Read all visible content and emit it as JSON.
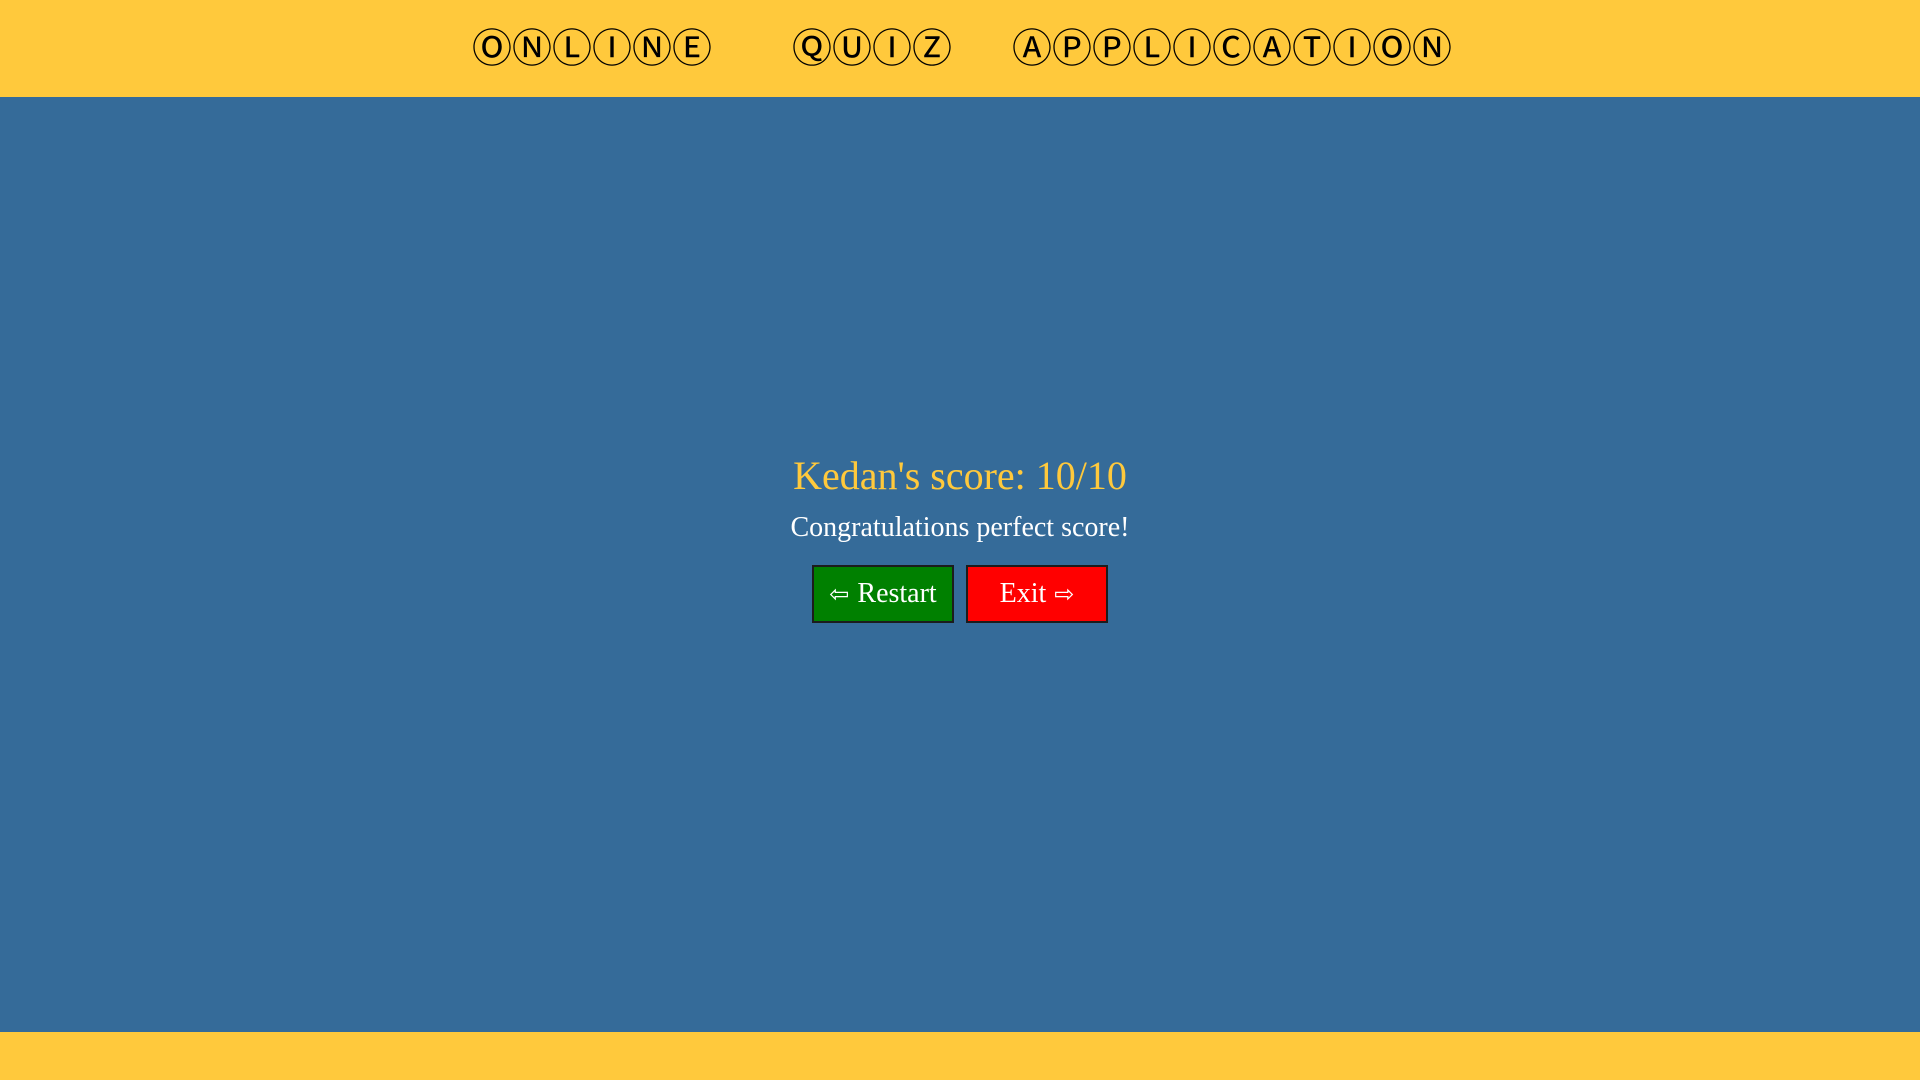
{
  "header": {
    "title_words": [
      "ⓄⓃⓁⒾⓃⒺ",
      "ⓆⓊⒾⓏ",
      "ⒶⓅⓅⓁⒾⒸⒶⓉⒾⓄⓃ"
    ]
  },
  "result": {
    "score_text": "Kedan's score: 10/10",
    "message": "Congratulations perfect score!"
  },
  "buttons": {
    "restart": {
      "icon": "⇦",
      "label": "Restart",
      "color": "#008000"
    },
    "exit": {
      "icon": "⇨",
      "label": "Exit",
      "color": "#ff0000"
    }
  },
  "colors": {
    "background": "#356b99",
    "bars": "#ffc93c",
    "score_text": "#ffc93c",
    "message_text": "#ffffff"
  }
}
